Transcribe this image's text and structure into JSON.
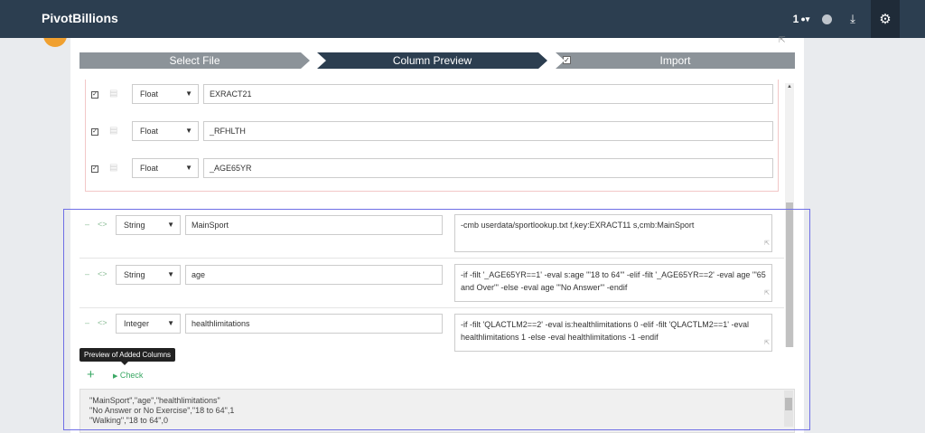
{
  "header": {
    "brand": "PivotBillions",
    "user_count": "1",
    "icons": [
      "user-icon",
      "status-dot-icon",
      "download-icon",
      "gear-icon"
    ]
  },
  "steps": [
    {
      "label": "Select File",
      "state": "done"
    },
    {
      "label": "Column Preview",
      "state": "active"
    },
    {
      "label": "Import",
      "state": "pending"
    }
  ],
  "original_columns": [
    {
      "type": "Float",
      "name": "EXRACT21",
      "checked": true
    },
    {
      "type": "Float",
      "name": "_RFHLTH",
      "checked": true
    },
    {
      "type": "Float",
      "name": "_AGE65YR",
      "checked": true
    }
  ],
  "added_columns": [
    {
      "type": "String",
      "name": "MainSport",
      "expr": "-cmb userdata/sportlookup.txt f,key:EXRACT11 s,cmb:MainSport"
    },
    {
      "type": "String",
      "name": "age",
      "expr": "-if -filt '_AGE65YR==1' -eval s:age '\"18 to 64\"' -elif -filt '_AGE65YR==2' -eval age '\"65 and Over\"' -else -eval age '\"No Answer\"' -endif"
    },
    {
      "type": "Integer",
      "name": "healthlimitations",
      "expr": "-if -filt 'QLACTLM2==2' -eval is:healthlimitations 0 -elif -filt 'QLACTLM2==1' -eval healthlimitations 1 -else -eval healthlimitations -1 -endif"
    }
  ],
  "controls": {
    "tooltip": "Preview of Added Columns",
    "add_label": "+",
    "check_label": "Check",
    "remove_symbol": "–",
    "code_symbol": "<>"
  },
  "preview_lines": [
    "\"MainSport\",\"age\",\"healthlimitations\"",
    "\"No Answer or No Exercise\",\"18 to 64\",1",
    "\"Walking\",\"18 to 64\",0"
  ],
  "colors": {
    "topbar": "#2c3e50",
    "active_step": "#2c3e50",
    "inactive_step": "#8c9399",
    "accent_green": "#3aa864",
    "highlight": "#6f6fe6"
  }
}
